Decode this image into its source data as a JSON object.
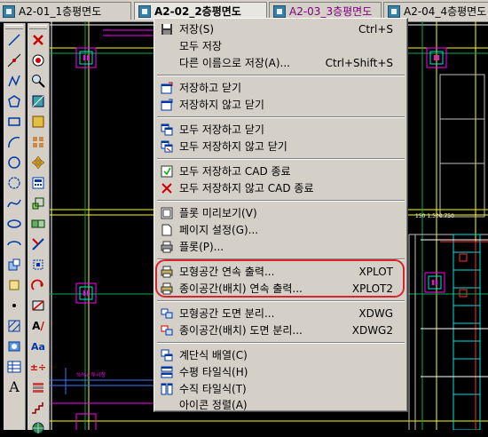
{
  "tabs": [
    {
      "label": "A2-01_1층평면도",
      "active": false,
      "color": "#000000"
    },
    {
      "label": "A2-02_2층평면도",
      "active": true,
      "color": "#000000"
    },
    {
      "label": "A2-03_3층평면도",
      "active": false,
      "color": "#800080"
    },
    {
      "label": "A2-04_4층평면도",
      "active": false,
      "color": "#000000"
    }
  ],
  "menu": {
    "items": [
      {
        "name": "save",
        "label": "저장(S)",
        "shortcut": "Ctrl+S",
        "icon": "floppy-icon"
      },
      {
        "name": "save-all",
        "label": "모두 저장",
        "shortcut": "",
        "icon": ""
      },
      {
        "name": "save-as",
        "label": "다른 이름으로 저장(A)...",
        "shortcut": "Ctrl+Shift+S",
        "icon": ""
      },
      {
        "name": "save-and-close",
        "label": "저장하고 닫기",
        "shortcut": "",
        "icon": "save-close-icon"
      },
      {
        "name": "close-without-save",
        "label": "저장하지 않고 닫기",
        "shortcut": "",
        "icon": "close-nosave-icon"
      },
      {
        "name": "save-all-close",
        "label": "모두 저장하고 닫기",
        "shortcut": "",
        "icon": "save-all-close-icon"
      },
      {
        "name": "close-all-without-save",
        "label": "모두 저장하지 않고 닫기",
        "shortcut": "",
        "icon": "close-all-nosave-icon"
      },
      {
        "name": "save-all-exit-cad",
        "label": "모두 저장하고 CAD 종료",
        "shortcut": "",
        "icon": "save-exit-icon"
      },
      {
        "name": "exit-cad-without-save",
        "label": "모두 저장하지 않고 CAD 종료",
        "shortcut": "",
        "icon": "red-x-icon"
      },
      {
        "name": "plot-preview",
        "label": "플롯 미리보기(V)",
        "shortcut": "",
        "icon": "preview-icon"
      },
      {
        "name": "page-setup",
        "label": "페이지 설정(G)...",
        "shortcut": "",
        "icon": "page-icon"
      },
      {
        "name": "plot",
        "label": "플롯(P)...",
        "shortcut": "",
        "icon": "printer-icon"
      },
      {
        "name": "model-batch-plot",
        "label": "모형공간 연속 출력...",
        "shortcut": "XPLOT",
        "icon": "batch-plot-icon"
      },
      {
        "name": "paper-batch-plot",
        "label": "종이공간(배치) 연속 출력...",
        "shortcut": "XPLOT2",
        "icon": "batch-plot-icon"
      },
      {
        "name": "model-split-drawing",
        "label": "모형공간 도면 분리...",
        "shortcut": "XDWG",
        "icon": "split-icon"
      },
      {
        "name": "paper-split-drawing",
        "label": "종이공간(배치) 도면 분리...",
        "shortcut": "XDWG2",
        "icon": "split-icon"
      },
      {
        "name": "cascade",
        "label": "계단식 배열(C)",
        "shortcut": "",
        "icon": "cascade-icon"
      },
      {
        "name": "tile-horizontal",
        "label": "수평 타일식(H)",
        "shortcut": "",
        "icon": "tile-horizontal-icon"
      },
      {
        "name": "tile-vertical",
        "label": "수직 타일식(T)",
        "shortcut": "",
        "icon": "tile-vertical-icon"
      },
      {
        "name": "arrange-icons",
        "label": "아이콘 정렬(A)",
        "shortcut": "",
        "icon": ""
      }
    ]
  },
  "drawing": {
    "dim_label": "150  1,500  750",
    "annotation": "%%c 투시창"
  },
  "colors": {
    "accent": "#d8242a",
    "magenta": "#ff00ff",
    "yellow": "#ffff00"
  }
}
